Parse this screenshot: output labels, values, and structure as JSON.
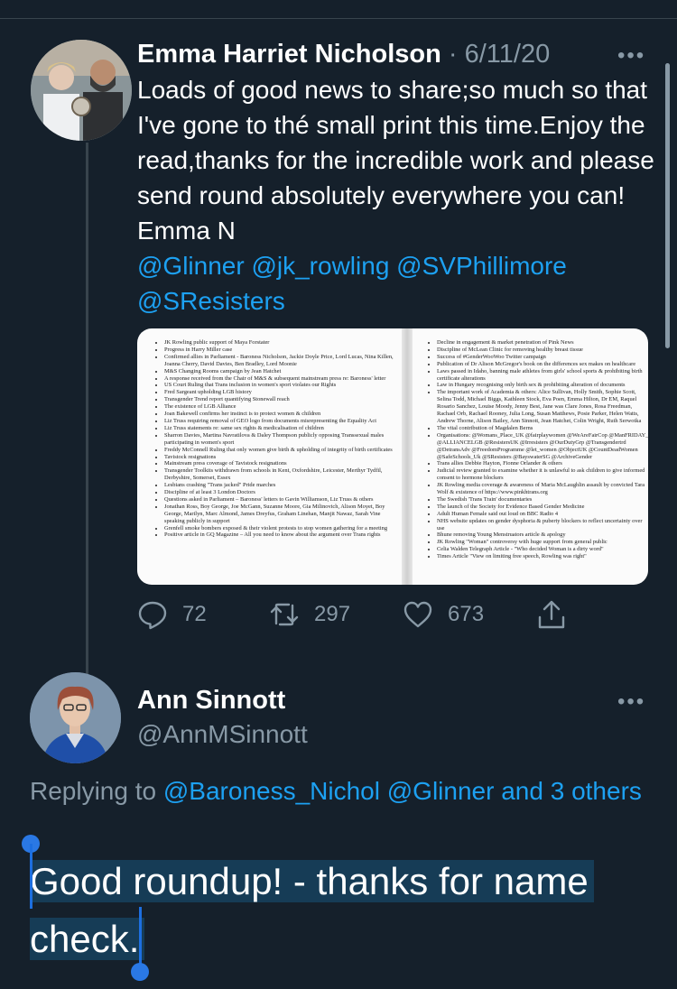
{
  "tweet1": {
    "author_name": "Emma Harriet Nicholson",
    "separator": " · ",
    "date": "6/11/20",
    "text": "Loads of good news to share;so much so that I've gone to thé small print this time.Enjoy the read,thanks for the incredible work and please send round absolutely everywhere you can! Emma N",
    "mentions_line1": "@Glinner @jk_rowling @SVPhillimore",
    "mentions_line2": "@SResisters",
    "more_icon": "more-dots-icon",
    "document_left": [
      "JK Rowling public support of Maya Forstater",
      "Progress in Harry Miller case",
      "Confirmed allies in Parliament - Baroness Nicholson, Jackie Doyle Price, Lord Lucas, Nina Killen, Joanna Cherry, David Davies, Ben Bradley, Lord Moonie",
      "M&S Changing Rooms campaign by Jean Hatchet",
      "A response received from the Chair of M&S & subsequent mainstream press re: Baroness' letter",
      "US Court Ruling that Trans inclusion in women's sport violates our Rights",
      "Fred Sargeant upholding LGB history",
      "Transgender Trend report quantifying Stonewall reach",
      "The existence of LGB Alliance",
      "Joan Bakewell confirms her instinct is to protect women & children",
      "Liz Truss requiring removal of GEO logo from documents misrepresenting the Equality Act",
      "Liz Truss statements re: same sex rights & medicalisation of children",
      "Sharron Davies, Martina Navratilova & Daley Thompson publicly opposing Transsexual males participating in women's sport",
      "Freddy McConnell Ruling that only women give birth & upholding of integrity of birth certificates",
      "Tavistock resignations",
      "Mainstream press coverage of Tavistock resignations",
      "Transgender Toolkits withdrawn from schools in Kent, Oxfordshire, Leicester, Merthyr Tydfil, Derbyshire, Somerset, Essex",
      "Lesbians crashing \"Trans jacked\" Pride marches",
      "Discipline of at least 3 London Doctors",
      "Questions asked in Parliament – Baroness' letters to Gavin Williamson, Liz Truss & others",
      "Jonathan Ross, Boy George, Joe McGann, Suzanne Moore, Gia Milinovich, Alison Moyet, Boy George, Marilyn, Marc Almond, James Dreyfus, Graham Linehan, Manjit Nawaz, Sarah Vine speaking publicly in support",
      "Grenfell smoke bombers exposed & their violent protests to stop women gathering for a meeting",
      "Positive article in GQ Magazine – All you need to know about the argument over Trans rights"
    ],
    "document_right": [
      "Decline in engagement & market penetration of Pink News",
      "Discipline of McLean Clinic for removing healthy breast tissue",
      "Success of #GenderWooWoo Twitter campaign",
      "Publication of Dr Alison McGregor's book on the differences sex makes on healthcare",
      "Laws passed in Idaho, banning male athletes from girls' school sports & prohibiting birth certificate alterations",
      "Law in Hungary recognising only birth sex & prohibiting alteration of documents",
      "The important work of Academia & others: Alice Sullivan, Holly Smith, Sophie Scott, Selina Todd, Michael Biggs, Kathleen Stock, Eva Poen, Emma Hilton, Dr EM, Raquel Rosario Sanchez, Louise Moody, Jenny Best, Jane was Clare Jones, Rosa Freedman, Rachael Orb, Rachael Rooney, Julia Long, Susan Matthews, Posie Parker, Helen Watts, Andrew Thorne, Alison Bailey, Ann Sinnott, Jean Hatchet, Colin Wright, Ruth Serwotka",
      "The vital contribution of Magdalen Berns",
      "Organisations: @Womans_Place_UK @fairplaywomen @WeAreFairCop @ManFRIDAY_ @ALLIANCELGB @ResistersUK @Irresisters @OurDutyGrp @Transgendertrd @DetransAdv @FreedomProgramme @let_women @ObjectUK @CountDeadWomen @SafeSchools_Uk @SResisters @BayswaterSG @ArchiveGender",
      "Trans allies Debbie Hayton, Fionne Orlander & others",
      "Judicial review granted to examine whether it is unlawful to ask children to give informed consent to hormone blockers",
      "JK Rowling media coverage & awareness of Maria McLaughlin assault by convicted Tara Wolf & existence of https://www.pinkhtrans.org",
      "The Swedish 'Trans Train' documentaries",
      "The launch of the Society for Evidence Based Gender Medicine",
      "Adult Human Female said out loud on BBC Radio 4",
      "NHS website updates on gender dysphoria & puberty blockers to reflect uncertainty over use",
      "Bhune removing Young Menstruators article & apology",
      "JK Rowling \"Woman\" controversy with huge support from general public",
      "Celia Walden Telegraph Article - \"Who decided Woman is a dirty word\"",
      "Times Article \"View on limiting free speech, Rowling was right\""
    ],
    "actions": {
      "reply_icon": "reply-icon",
      "reply_count": "72",
      "retweet_icon": "retweet-icon",
      "retweet_count": "297",
      "like_icon": "heart-icon",
      "like_count": "673",
      "share_icon": "share-icon"
    }
  },
  "tweet2": {
    "author_name": "Ann Sinnott",
    "handle": "@AnnMSinnott",
    "more_icon": "more-dots-icon",
    "replying_prefix": "Replying to ",
    "replying_mentions": "@Baroness_Nichol @Glinner",
    "replying_suffix": "and 3 others",
    "text_line1": "Good roundup! - thanks for name",
    "text_line2": "check."
  },
  "colors": {
    "background": "#15202b",
    "text": "#ffffff",
    "muted": "#8899a6",
    "accent": "#1da1f2",
    "selection": "#1d6fe0"
  }
}
